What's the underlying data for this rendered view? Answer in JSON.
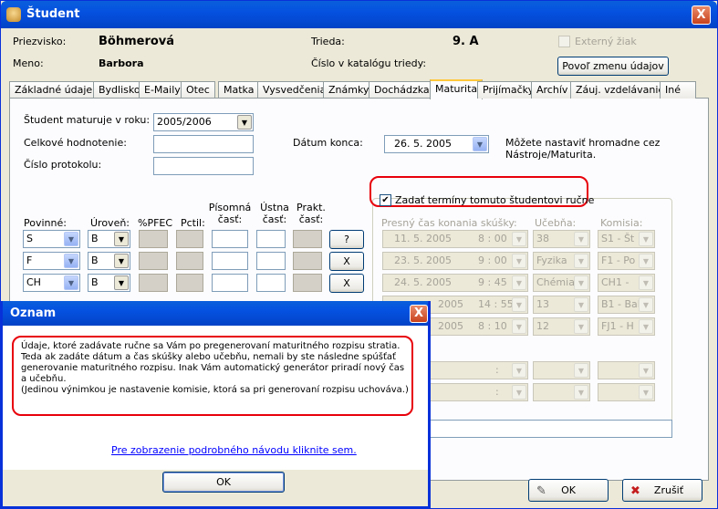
{
  "window": {
    "title": "Študent",
    "close": "X"
  },
  "header": {
    "priezvisko_label": "Priezvisko:",
    "priezvisko": "Böhmerová",
    "meno_label": "Meno:",
    "meno": "Barbora",
    "trieda_label": "Trieda:",
    "trieda": "9. A",
    "cislo_label": "Číslo v katalógu triedy:",
    "externy_label": "Externý žiak",
    "povol_btn": "Povoľ zmenu údajov"
  },
  "tabs": [
    "Základné údaje",
    "Bydlisko",
    "E-Maily",
    "Otec",
    "Matka",
    "Vysvedčenia",
    "Známky",
    "Dochádzka",
    "Maturita",
    "Prijímačky",
    "Archív",
    "Záuj. vzdelávanie",
    "Iné"
  ],
  "maturita": {
    "rok_label": "Študent maturuje v roku:",
    "rok": "2005/2006",
    "hodnotenie_label": "Celkové hodnotenie:",
    "protokol_label": "Číslo protokolu:",
    "datum_label": "Dátum konca:",
    "datum": "26.   5. 2005",
    "note": "Môžete nastaviť hromadne cez Nástroje/Maturita.",
    "zadat_label": "Zadať termíny tomuto študentovi ručne"
  },
  "subjects_headers": {
    "povinne": "Povinné:",
    "uroven": "Úroveň:",
    "pfec": "%PFEC",
    "pctil": "Pctil:",
    "pisomna": "Písomná časť:",
    "ustna": "Ústna časť:",
    "prakt": "Prakt. časť:"
  },
  "subjects": [
    {
      "name": "S",
      "level": "B",
      "action": "?"
    },
    {
      "name": "F",
      "level": "B",
      "action": "X"
    },
    {
      "name": "CH",
      "level": "B",
      "action": "X"
    }
  ],
  "exam_headers": {
    "cas": "Presný čas konania skúšky:",
    "ucebna": "Učebňa:",
    "komisia": "Komisia:"
  },
  "exams": [
    {
      "date": "11.   5. 2005",
      "time": "8 : 00",
      "room": "38",
      "com": "S1 - Št"
    },
    {
      "date": "23.   5. 2005",
      "time": "9 : 00",
      "room": "Fyzika",
      "com": "F1 - Po"
    },
    {
      "date": "24.   5. 2005",
      "time": "9 : 45",
      "room": "Chémia",
      "com": "CH1 -"
    },
    {
      "date": "2005",
      "time": "14 : 55",
      "room": "13",
      "com": "B1 - Bal"
    },
    {
      "date": "2005",
      "time": "8 : 10",
      "room": "12",
      "com": "FJ1 - H"
    }
  ],
  "colon": ":",
  "buttons": {
    "ok": "OK",
    "zrusit": "Zrušiť"
  },
  "dialog": {
    "title": "Oznam",
    "close": "X",
    "message": "Údaje, ktoré zadávate ručne sa Vám po pregenerovaní maturitného rozpisu stratia. Teda ak zadáte dátum a čas skúšky alebo učebňu, nemali by ste následne spúšťať generovanie maturitného rozpisu. Inak Vám automatický generátor priradí nový čas a učebňu.\n(Jedinou výnimkou je nastavenie komisie, ktorá sa pri generovaní rozpisu uchováva.)",
    "link": "Pre zobrazenie podrobného návodu kliknite sem.",
    "ok": "OK"
  }
}
